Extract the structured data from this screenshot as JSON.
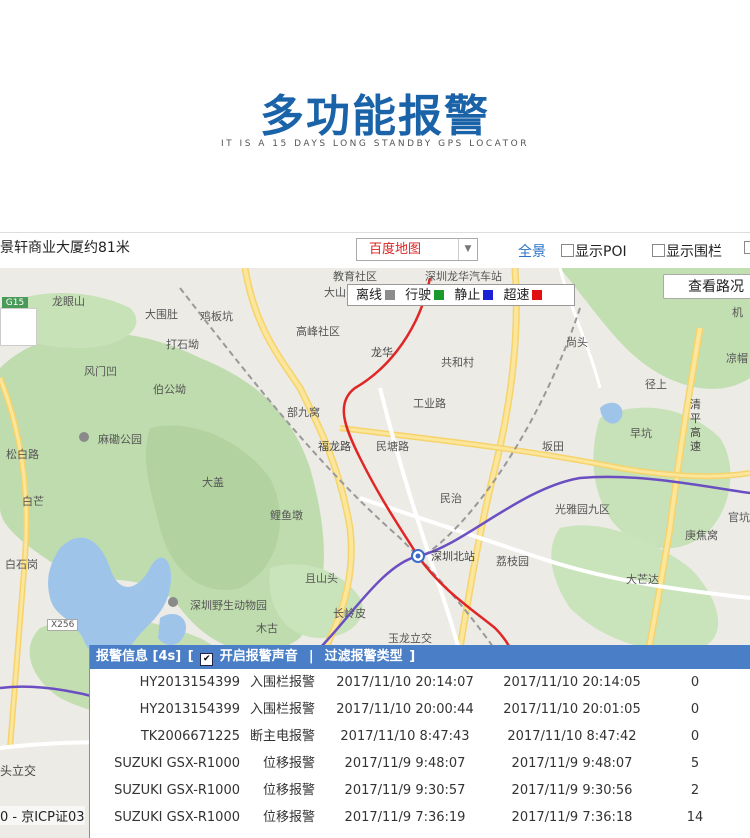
{
  "header": {
    "title": "多功能报警",
    "subtitle": "IT IS A 15 DAYS LONG STANDBY GPS LOCATOR"
  },
  "toolbar": {
    "address": "景轩商业大厦约81米",
    "map_type": "百度地图",
    "full_view": "全景",
    "show_poi": "显示POI",
    "show_fence": "显示围栏"
  },
  "map": {
    "legend": [
      {
        "label": "离线",
        "color": "#8c8c8c"
      },
      {
        "label": "行驶",
        "color": "#1a9a2a"
      },
      {
        "label": "静止",
        "color": "#1b22d6"
      },
      {
        "label": "超速",
        "color": "#e01010"
      }
    ],
    "traffic_button": "查看路况",
    "highway_badge": "G15",
    "road_badge": "X256",
    "icp_text": "0 - 京ICP证03",
    "labels": {
      "l1": "教育社区",
      "l2": "深圳龙华汽车站",
      "l3": "大山",
      "l4": "龙眼山",
      "l5": "大围肚",
      "l6": "鸡板坑",
      "l7": "高峰社区",
      "l8": "打石坳",
      "l9": "龙华",
      "l10": "共和村",
      "l11": "风门凹",
      "l12": "伯公坳",
      "l13": "工业路",
      "l14": "部九窝",
      "l15": "麻磡公园",
      "l16": "福龙路",
      "l17": "民塘路",
      "l18": "坂田",
      "l19": "松白路",
      "l20": "白芒",
      "l21": "大盖",
      "l22": "民治",
      "l23": "光雅园九区",
      "l24": "鲤鱼墩",
      "l25": "深圳北站",
      "l26": "荔枝园",
      "l27": "白石岗",
      "l28": "且山头",
      "l29": "深圳野生动物园",
      "l30": "长岭皮",
      "l31": "木古",
      "l32": "玉龙立交",
      "l33": "尚头",
      "l34": "径上",
      "l35": "早坑",
      "l36": "清平高速",
      "l37": "庚焦窝",
      "l38": "大芒达",
      "l39": "官坑",
      "l40": "机",
      "l41": "凉帽",
      "l42": "头立交"
    }
  },
  "alarm_panel": {
    "title": "报警信息 [4s]",
    "open_sound": "开启报警声音",
    "separator": "|",
    "filter_types": "过滤报警类型",
    "open_bracket": "[",
    "close_bracket": "]",
    "rows": [
      {
        "device": "HY2013154399",
        "type": "入围栏报警",
        "start": "2017/11/10 20:14:07",
        "end": "2017/11/10 20:14:05",
        "count": "0"
      },
      {
        "device": "HY2013154399",
        "type": "入围栏报警",
        "start": "2017/11/10 20:00:44",
        "end": "2017/11/10 20:01:05",
        "count": "0"
      },
      {
        "device": "TK2006671225",
        "type": "断主电报警",
        "start": "2017/11/10 8:47:43",
        "end": "2017/11/10 8:47:42",
        "count": "0"
      },
      {
        "device": "SUZUKI GSX-R1000",
        "type": "位移报警",
        "start": "2017/11/9 9:48:07",
        "end": "2017/11/9 9:48:07",
        "count": "5"
      },
      {
        "device": "SUZUKI GSX-R1000",
        "type": "位移报警",
        "start": "2017/11/9 9:30:57",
        "end": "2017/11/9 9:30:56",
        "count": "2"
      },
      {
        "device": "SUZUKI GSX-R1000",
        "type": "位移报警",
        "start": "2017/11/9 7:36:19",
        "end": "2017/11/9 7:36:18",
        "count": "14"
      }
    ]
  }
}
